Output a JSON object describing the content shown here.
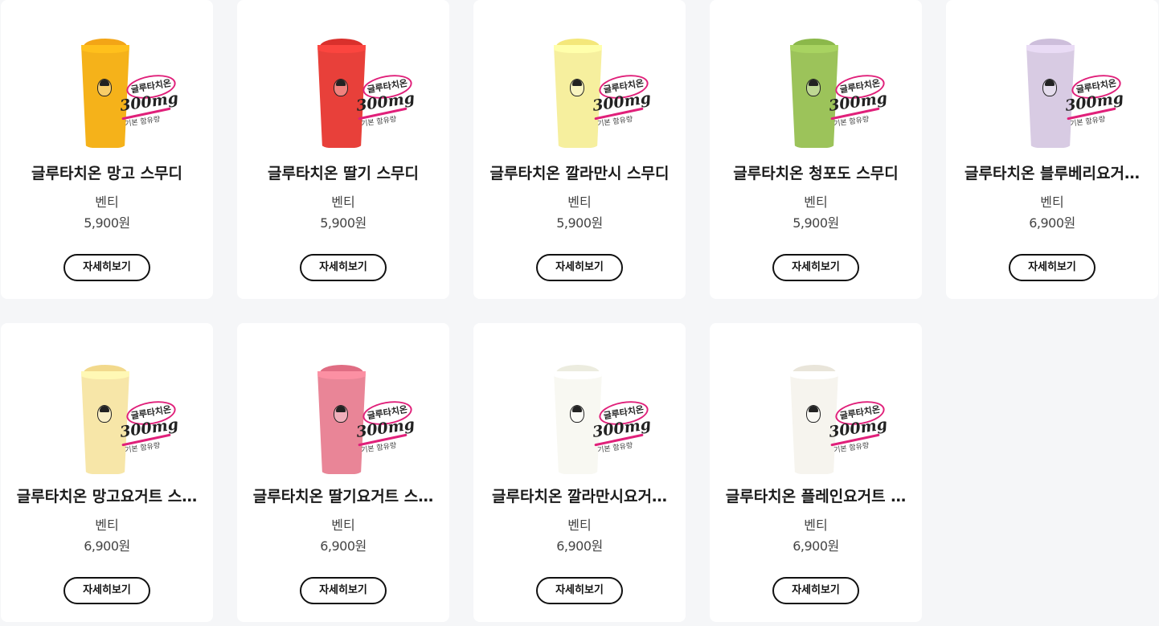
{
  "products": [
    {
      "name": "글루타치온 망고 스무디",
      "size": "벤티",
      "price": "5,900원",
      "button": "자세히보기",
      "cup_color": "#f5b21a",
      "top_color": "#f3a516",
      "sticker": {
        "brand": "글루타치온",
        "amount": "300mg",
        "sub": "기본 함유량"
      }
    },
    {
      "name": "글루타치온 딸기 스무디",
      "size": "벤티",
      "price": "5,900원",
      "button": "자세히보기",
      "cup_color": "#e8403a",
      "top_color": "#d9302c",
      "sticker": {
        "brand": "글루타치온",
        "amount": "300mg",
        "sub": "기본 함유량"
      }
    },
    {
      "name": "글루타치온 깔라만시 스무디",
      "size": "벤티",
      "price": "5,900원",
      "button": "자세히보기",
      "cup_color": "#f6ef9e",
      "top_color": "#f4e77a",
      "sticker": {
        "brand": "글루타치온",
        "amount": "300mg",
        "sub": "기본 함유량"
      }
    },
    {
      "name": "글루타치온 청포도 스무디",
      "size": "벤티",
      "price": "5,900원",
      "button": "자세히보기",
      "cup_color": "#9cc35a",
      "top_color": "#8bb84a",
      "sticker": {
        "brand": "글루타치온",
        "amount": "300mg",
        "sub": "기본 함유량"
      }
    },
    {
      "name": "글루타치온 블루베리요거…",
      "size": "벤티",
      "price": "6,900원",
      "button": "자세히보기",
      "cup_color": "#d8cbe3",
      "top_color": "#cdbedb",
      "sticker": {
        "brand": "글루타치온",
        "amount": "300mg",
        "sub": "기본 함유량"
      }
    },
    {
      "name": "글루타치온 망고요거트 스…",
      "size": "벤티",
      "price": "6,900원",
      "button": "자세히보기",
      "cup_color": "#f7e6a8",
      "top_color": "#f2d98c",
      "sticker": {
        "brand": "글루타치온",
        "amount": "300mg",
        "sub": "기본 함유량"
      }
    },
    {
      "name": "글루타치온 딸기요거트 스…",
      "size": "벤티",
      "price": "6,900원",
      "button": "자세히보기",
      "cup_color": "#e98597",
      "top_color": "#e06d83",
      "sticker": {
        "brand": "글루타치온",
        "amount": "300mg",
        "sub": "기본 함유량"
      }
    },
    {
      "name": "글루타치온 깔라만시요거…",
      "size": "벤티",
      "price": "6,900원",
      "button": "자세히보기",
      "cup_color": "#f8f8f2",
      "top_color": "#ececdf",
      "sticker": {
        "brand": "글루타치온",
        "amount": "300mg",
        "sub": "기본 함유량"
      }
    },
    {
      "name": "글루타치온 플레인요거트 …",
      "size": "벤티",
      "price": "6,900원",
      "button": "자세히보기",
      "cup_color": "#f6f4ee",
      "top_color": "#e9e5da",
      "sticker": {
        "brand": "글루타치온",
        "amount": "300mg",
        "sub": "기본 함유량"
      }
    }
  ]
}
